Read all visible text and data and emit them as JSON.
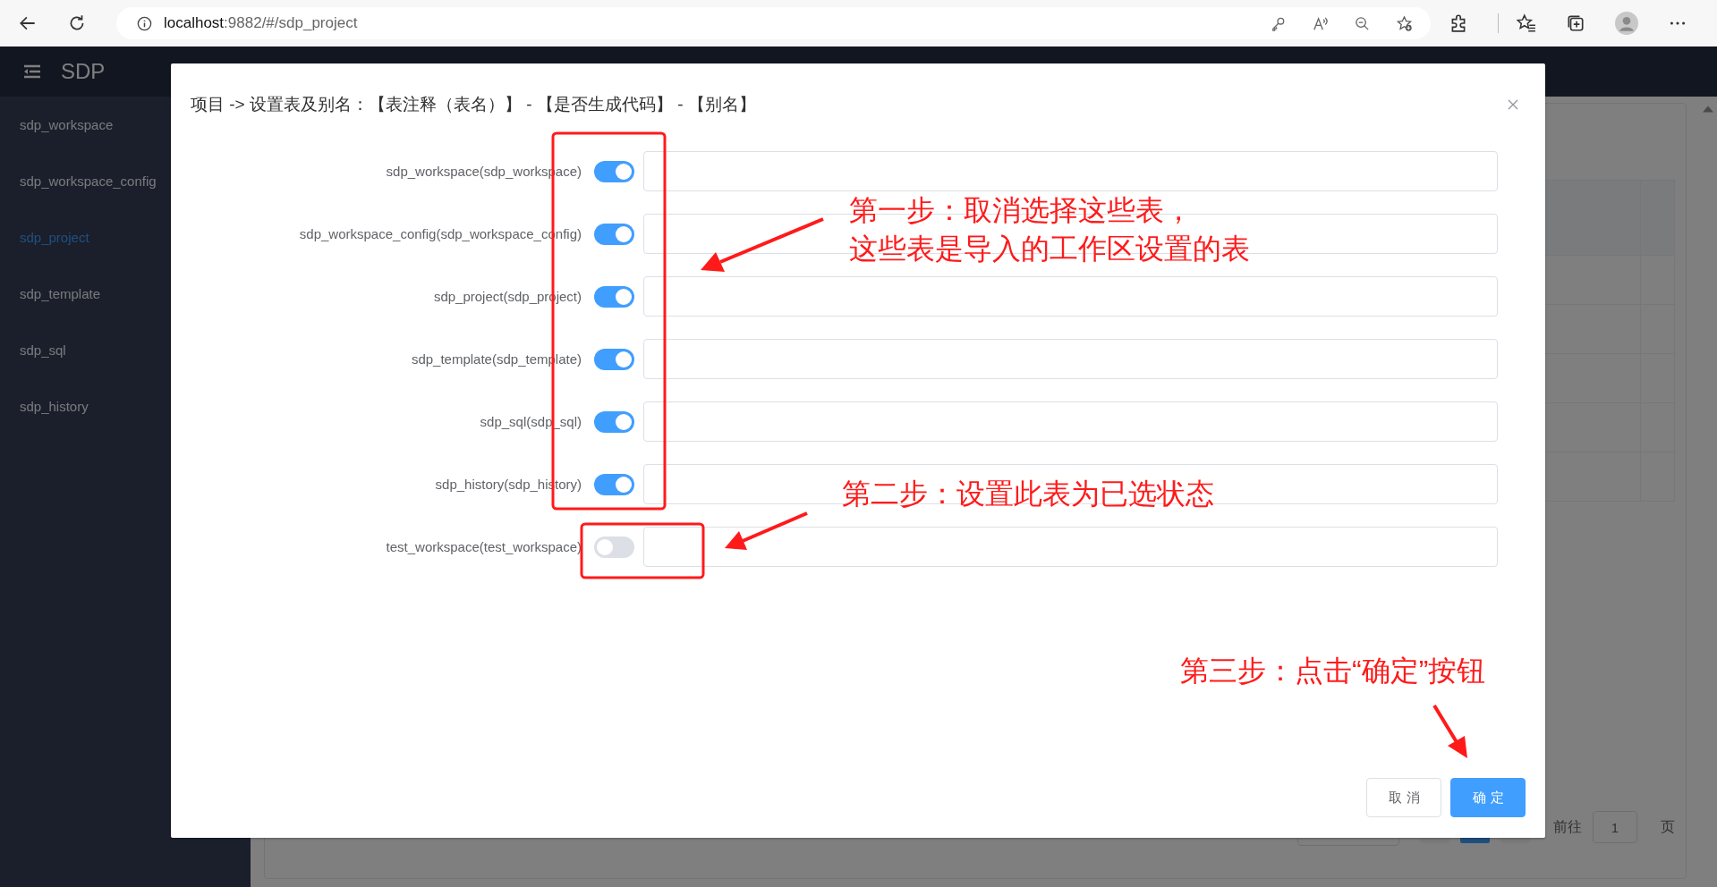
{
  "browser": {
    "address": {
      "host": "localhost",
      "path": ":9882/#/sdp_project"
    }
  },
  "app": {
    "title": "SDP"
  },
  "sidebar": {
    "items": [
      {
        "label": "sdp_workspace",
        "selected": false
      },
      {
        "label": "sdp_workspace_config",
        "selected": false
      },
      {
        "label": "sdp_project",
        "selected": true
      },
      {
        "label": "sdp_template",
        "selected": false
      },
      {
        "label": "sdp_sql",
        "selected": false
      },
      {
        "label": "sdp_history",
        "selected": false
      }
    ]
  },
  "pagination": {
    "pages": [
      {
        "selected": false
      },
      {
        "selected": true
      },
      {
        "selected": false
      }
    ],
    "jump_label": "前往",
    "page_value": "1",
    "page_unit": "页"
  },
  "dialog": {
    "title": "项目 -> 设置表及别名：【表注释（表名）】 - 【是否生成代码】 - 【别名】",
    "rows": [
      {
        "label": "sdp_workspace(sdp_workspace)",
        "on": true
      },
      {
        "label": "sdp_workspace_config(sdp_workspace_config)",
        "on": true
      },
      {
        "label": "sdp_project(sdp_project)",
        "on": true
      },
      {
        "label": "sdp_template(sdp_template)",
        "on": true
      },
      {
        "label": "sdp_sql(sdp_sql)",
        "on": true
      },
      {
        "label": "sdp_history(sdp_history)",
        "on": true
      },
      {
        "label": "test_workspace(test_workspace)",
        "on": false
      }
    ],
    "buttons": [
      {
        "label": "取消",
        "kind": "default"
      },
      {
        "label": "确定",
        "kind": "primary"
      }
    ]
  },
  "annotations": [
    {
      "lines": [
        "第一步：取消选择这些表，",
        "这些表是导入的工作区设置的表"
      ]
    },
    {
      "lines": [
        "第二步：设置此表为已选状态"
      ]
    },
    {
      "lines": [
        "第三步：点击“确定”按钮"
      ]
    }
  ]
}
